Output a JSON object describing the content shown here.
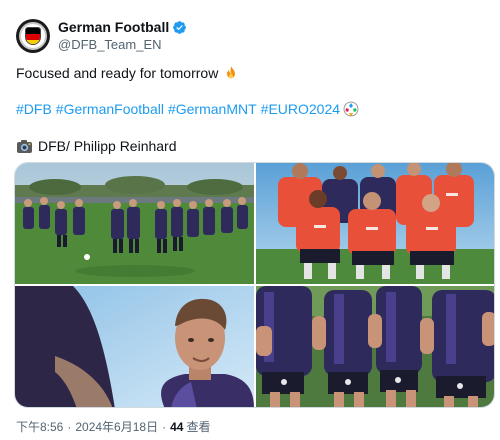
{
  "account": {
    "display_name": "German Football",
    "handle": "@DFB_Team_EN",
    "avatar_icon": "dfb-crest-icon",
    "verified_icon": "verified-badge-icon"
  },
  "tweet": {
    "text": "Focused and ready for tomorrow",
    "emoji_icon": "fire-emoji-icon",
    "hashtags": [
      "#DFB",
      "#GermanFootball",
      "#GermanMNT",
      "#EURO2024"
    ],
    "hashtag_emoji_icon": "euro2024-ball-icon",
    "credit": "DFB/ Philipp Reinhard",
    "credit_icon": "camera-emoji-icon"
  },
  "media": {
    "photos": [
      {
        "name": "photo-team-training-circle"
      },
      {
        "name": "photo-players-group-pose"
      },
      {
        "name": "photo-player-portrait"
      },
      {
        "name": "photo-players-running"
      }
    ]
  },
  "meta": {
    "time": "下午8:56",
    "separator": "·",
    "date": "2024年6月18日",
    "views_count": "44",
    "views_label": "查看"
  },
  "colors": {
    "link": "#1d9bf0",
    "secondary_text": "#536471",
    "primary_text": "#0f1419",
    "verified": "#1d9bf0"
  }
}
